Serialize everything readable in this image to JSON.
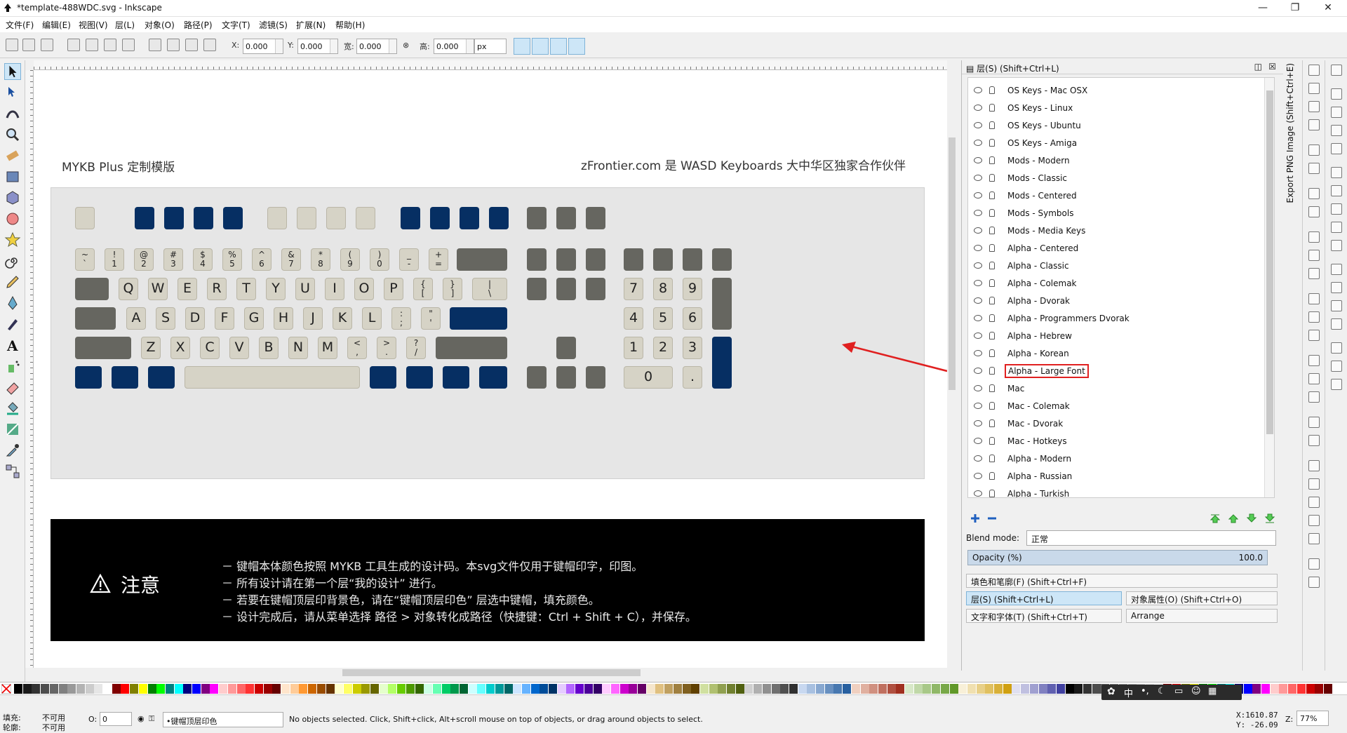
{
  "window": {
    "title": "*template-488WDC.svg - Inkscape",
    "minimize": "—",
    "maximize": "❐",
    "close": "✕"
  },
  "menu": [
    "文件(F)",
    "编辑(E)",
    "视图(V)",
    "层(L)",
    "对象(O)",
    "路径(P)",
    "文字(T)",
    "滤镜(S)",
    "扩展(N)",
    "帮助(H)"
  ],
  "toolbar": {
    "x_label": "X:",
    "x_value": "0.000",
    "y_label": "Y:",
    "y_value": "0.000",
    "w_label": "宽:",
    "w_value": "0.000",
    "h_label": "高:",
    "h_value": "0.000",
    "unit": "px"
  },
  "canvas": {
    "title_left": "MYKB Plus 定制模版",
    "title_right": "zFrontier.com 是 WASD Keyboards 大中华区独家合作伙伴",
    "notice_title": "注意",
    "notice_lines": [
      "－ 键帽本体颜色按照 MYKB 工具生成的设计码。本svg文件仅用于键帽印字，印图。",
      "－ 所有设计请在第一个层“我的设计” 进行。",
      "－ 若要在键帽顶层印背景色，请在“键帽顶层印色” 层选中键帽，填充颜色。",
      "－ 设计完成后，请从菜单选择 路径 > 对象转化成路径（快捷键：Ctrl + Shift + C），并保存。"
    ]
  },
  "keys": {
    "num_row": [
      [
        "~",
        "`"
      ],
      [
        "!",
        "1"
      ],
      [
        "@",
        "2"
      ],
      [
        "#",
        "3"
      ],
      [
        "$",
        "4"
      ],
      [
        "%",
        "5"
      ],
      [
        "^",
        "6"
      ],
      [
        "&",
        "7"
      ],
      [
        "*",
        "8"
      ],
      [
        "(",
        "9"
      ],
      [
        ")",
        "0"
      ],
      [
        "_",
        "-"
      ],
      [
        "+",
        "="
      ]
    ],
    "qwerty": [
      "Q",
      "W",
      "E",
      "R",
      "T",
      "Y",
      "U",
      "I",
      "O",
      "P"
    ],
    "qwerty_brackets": [
      [
        "{",
        "["
      ],
      [
        "}",
        "]"
      ],
      [
        "|",
        "\\"
      ]
    ],
    "asdf": [
      "A",
      "S",
      "D",
      "F",
      "G",
      "H",
      "J",
      "K",
      "L"
    ],
    "asdf_punct": [
      [
        ":",
        ";"
      ],
      [
        "\"",
        "'"
      ]
    ],
    "zxcv": [
      "Z",
      "X",
      "C",
      "V",
      "B",
      "N",
      "M"
    ],
    "zxcv_punct": [
      [
        "<",
        ","
      ],
      [
        ">",
        "."
      ],
      [
        "?",
        "/"
      ]
    ],
    "numpad_row1": [
      "7",
      "8",
      "9"
    ],
    "numpad_row2": [
      "4",
      "5",
      "6"
    ],
    "numpad_row3": [
      "1",
      "2",
      "3"
    ],
    "numpad_zero": "0",
    "numpad_dot": "."
  },
  "layers_panel": {
    "header": "层(S) (Shift+Ctrl+L)",
    "layers": [
      "OS Keys - Mac OSX",
      "OS Keys - Linux",
      "OS Keys - Ubuntu",
      "OS Keys - Amiga",
      "Mods - Modern",
      "Mods - Classic",
      "Mods - Centered",
      "Mods - Symbols",
      "Mods - Media Keys",
      "Alpha - Centered",
      "Alpha - Classic",
      "Alpha - Colemak",
      "Alpha - Dvorak",
      "Alpha - Programmers Dvorak",
      "Alpha - Hebrew",
      "Alpha - Korean",
      "Alpha - Large Font",
      "Mac",
      "Mac - Colemak",
      "Mac - Dvorak",
      "Mac - Hotkeys",
      "Alpha - Modern",
      "Alpha - Russian",
      "Alpha - Turkish"
    ],
    "highlighted_index": 16,
    "blend_label": "Blend mode:",
    "blend_value": "正常",
    "opacity_label": "Opacity (%)",
    "opacity_value": "100.0",
    "docks": {
      "fill_stroke": "填色和笔廓(F) (Shift+Ctrl+F)",
      "layers": "层(S) (Shift+Ctrl+L)",
      "object_props": "对象属性(O) (Shift+Ctrl+O)",
      "text_font": "文字和字体(T) (Shift+Ctrl+T)",
      "arrange": "Arrange"
    }
  },
  "export_strip": "Export PNG Image (Shift+Ctrl+E)",
  "status": {
    "fill_label": "填充:",
    "fill_value": "不可用",
    "stroke_label": "轮廓:",
    "stroke_value": "不可用",
    "opacity_label": "O:",
    "opacity_value": "0",
    "layer_name": "•键帽顶层印色",
    "message": "No objects selected. Click, Shift+click, Alt+scroll mouse on top of objects, or drag around objects to select.",
    "x_coord": "X:1610.87",
    "y_coord": "Y: -26.09",
    "zoom_label": "Z:",
    "zoom_value": "77%"
  },
  "colors": {
    "navy": "#062f63",
    "dark_gray": "#666660",
    "beige": "#d6d3c6",
    "highlight": "#e02020"
  }
}
